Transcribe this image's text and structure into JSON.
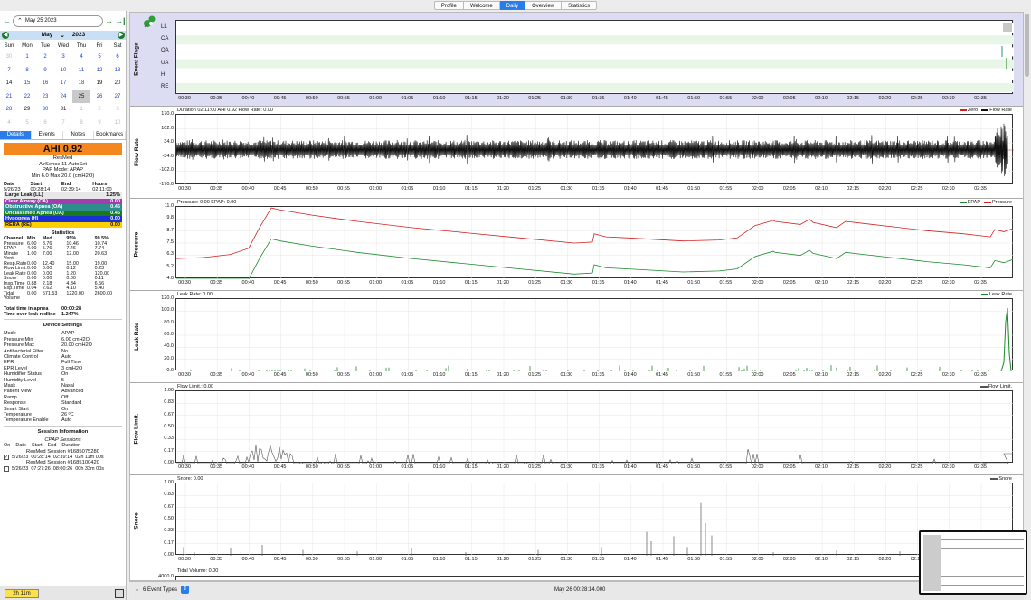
{
  "top_tabs": [
    "Profile",
    "Welcome",
    "Daily",
    "Overview",
    "Statistics"
  ],
  "active_tab": "Daily",
  "date_nav": {
    "date": "May 25 2023",
    "prev": "←",
    "next": "→",
    "last": "→|"
  },
  "calendar": {
    "month": "May",
    "year": "2023",
    "weekdays": [
      "Sun",
      "Mon",
      "Tue",
      "Wed",
      "Thu",
      "Fri",
      "Sat"
    ],
    "days": [
      {
        "d": "30",
        "t": "other"
      },
      {
        "d": "1",
        "t": "blue"
      },
      {
        "d": "2",
        "t": "blue"
      },
      {
        "d": "3",
        "t": "blue"
      },
      {
        "d": "4",
        "t": "blue"
      },
      {
        "d": "5",
        "t": "blue"
      },
      {
        "d": "6",
        "t": "blue"
      },
      {
        "d": "7",
        "t": "blue"
      },
      {
        "d": "8",
        "t": "blue"
      },
      {
        "d": "9",
        "t": "blue"
      },
      {
        "d": "10",
        "t": "blue"
      },
      {
        "d": "11",
        "t": "blue"
      },
      {
        "d": "12",
        "t": "blue"
      },
      {
        "d": "13",
        "t": "blue"
      },
      {
        "d": "14",
        "t": "black"
      },
      {
        "d": "15",
        "t": "blue"
      },
      {
        "d": "16",
        "t": "blue"
      },
      {
        "d": "17",
        "t": "blue"
      },
      {
        "d": "18",
        "t": "blue"
      },
      {
        "d": "19",
        "t": "black"
      },
      {
        "d": "20",
        "t": "black"
      },
      {
        "d": "21",
        "t": "blue"
      },
      {
        "d": "22",
        "t": "blue"
      },
      {
        "d": "23",
        "t": "blue"
      },
      {
        "d": "24",
        "t": "blue"
      },
      {
        "d": "25",
        "t": "sel"
      },
      {
        "d": "26",
        "t": "blue"
      },
      {
        "d": "27",
        "t": "blue"
      },
      {
        "d": "28",
        "t": "blue"
      },
      {
        "d": "29",
        "t": "black"
      },
      {
        "d": "30",
        "t": "blue"
      },
      {
        "d": "31",
        "t": "black"
      },
      {
        "d": "1",
        "t": "other"
      },
      {
        "d": "2",
        "t": "other"
      },
      {
        "d": "3",
        "t": "other"
      },
      {
        "d": "4",
        "t": "other"
      },
      {
        "d": "5",
        "t": "other"
      },
      {
        "d": "6",
        "t": "other"
      },
      {
        "d": "7",
        "t": "other"
      },
      {
        "d": "8",
        "t": "other"
      },
      {
        "d": "9",
        "t": "other"
      },
      {
        "d": "10",
        "t": "other"
      }
    ]
  },
  "left_tabs": [
    "Details",
    "Events",
    "Notes",
    "Bookmarks"
  ],
  "summary": {
    "ahi": "AHI 0.92",
    "machine_brand": "ResMed",
    "machine_model": "AirSense 11 AutoSet",
    "pap_mode": "PAP Mode: APAP",
    "pressure_range": "Min 6.0 Max 20.0 (cmH2O)",
    "headers": [
      "Date",
      "Start",
      "End",
      "Hours"
    ],
    "row": [
      "5/26/23",
      "00:28:14",
      "02:39:14",
      "02:11:00"
    ]
  },
  "events": [
    {
      "name": "Large Leak (LL)",
      "value": "1.25%",
      "bg": "#e8e8e8",
      "fg": "#111111"
    },
    {
      "name": "Clear Airway (CA)",
      "value": "0.00",
      "bg": "#a23db0",
      "fg": "#ffffff"
    },
    {
      "name": "Obstructive Apnea (OA)",
      "value": "0.46",
      "bg": "#2d8c8c",
      "fg": "#ffffff"
    },
    {
      "name": "Unclassified Apnea (UA)",
      "value": "0.46",
      "bg": "#1a7a1a",
      "fg": "#ffffff"
    },
    {
      "name": "Hypopnea (H)",
      "value": "0.00",
      "bg": "#1a2fd4",
      "fg": "#ffffff"
    },
    {
      "name": "RERA (RE)",
      "value": "0.00",
      "bg": "#ffd000",
      "fg": "#111111"
    }
  ],
  "statistics": {
    "title": "Statistics",
    "headers": [
      "Channel",
      "Min",
      "Med",
      "95%",
      "99.5%"
    ],
    "rows": [
      [
        "Pressure",
        "6.00",
        "8.76",
        "10.46",
        "10.74"
      ],
      [
        "EPAP",
        "4.00",
        "5.76",
        "7.46",
        "7.74"
      ],
      [
        "Minute Vent.",
        "1.00",
        "7.00",
        "12.00",
        "20.63"
      ],
      [
        "Resp.Rate",
        "0.00",
        "12.40",
        "15.00",
        "19.00"
      ],
      [
        "Flow Limit.",
        "0.00",
        "0.00",
        "0.12",
        "0.23"
      ],
      [
        "Leak Rate",
        "0.00",
        "0.00",
        "1.20",
        "120.00"
      ],
      [
        "Snore",
        "0.00",
        "0.00",
        "0.00",
        "0.11"
      ],
      [
        "Insp.Time",
        "0.88",
        "2.18",
        "4.34",
        "6.56"
      ],
      [
        "Exp.Time",
        "0.04",
        "2.62",
        "4.10",
        "5.40"
      ],
      [
        "Tidal Volume",
        "0.00",
        "571.53",
        "1220.00",
        "2600.00"
      ]
    ]
  },
  "totals": [
    {
      "k": "Total time in apnea",
      "v": "00:00:28"
    },
    {
      "k": "Time over leak redline",
      "v": "1.247%"
    }
  ],
  "device_settings": {
    "title": "Device Settings",
    "items": [
      {
        "k": "Mode",
        "v": "APAP"
      },
      {
        "k": "Pressure Min",
        "v": "6.00 cmH2O"
      },
      {
        "k": "Pressure Max",
        "v": "20.00 cmH2O"
      },
      {
        "k": "Antibacterial Filter",
        "v": "No"
      },
      {
        "k": "Climate Control",
        "v": "Auto"
      },
      {
        "k": "EPR",
        "v": "Full Time"
      },
      {
        "k": "EPR Level",
        "v": "3 cmH2O"
      },
      {
        "k": "Humidifier Status",
        "v": "On"
      },
      {
        "k": "Humidity Level",
        "v": "5"
      },
      {
        "k": "Mask",
        "v": "Nasal"
      },
      {
        "k": "Patient View",
        "v": "Advanced"
      },
      {
        "k": "Ramp",
        "v": "Off"
      },
      {
        "k": "Response",
        "v": "Standard"
      },
      {
        "k": "Smart Start",
        "v": "On"
      },
      {
        "k": "Temperature",
        "v": "26 ºC"
      },
      {
        "k": "Temperature Enable",
        "v": "Auto"
      }
    ]
  },
  "session_info": {
    "title": "Session Information",
    "subtitle": "CPAP Sessions",
    "headers": [
      "On",
      "Date",
      "Start",
      "End",
      "Duration"
    ],
    "sessions": [
      {
        "label": "ResMed Session #1685075280",
        "checked": true,
        "date": "5/26/23",
        "start": "00:28:14",
        "end": "02:39:14",
        "dur": "02h 11m 00s"
      },
      {
        "label": "ResMed Session #1685100420",
        "checked": false,
        "date": "5/26/23",
        "start": "07:27:26",
        "end": "08:00:26",
        "dur": "00h 33m 00s"
      }
    ]
  },
  "duration_badge": "2h 11m",
  "x_ticks": [
    "00:30",
    "00:35",
    "00:40",
    "00:45",
    "00:50",
    "00:55",
    "01:00",
    "01:05",
    "01:10",
    "01:15",
    "01:20",
    "01:25",
    "01:30",
    "01:35",
    "01:40",
    "01:45",
    "01:50",
    "01:55",
    "02:00",
    "02:05",
    "02:10",
    "02:15",
    "02:20",
    "02:25",
    "02:30",
    "02:35"
  ],
  "graphs": {
    "event_flags": {
      "ylabel": "Event Flags",
      "flags": [
        "LL",
        "CA",
        "OA",
        "UA",
        "H",
        "RE"
      ]
    },
    "flow_rate": {
      "ylabel": "Flow Rate",
      "header": "Duration 02:11:00 AHI 0.92 Flow Rate: 0.00",
      "ticks": [
        "170.0",
        "102.0",
        "34.0",
        "-34.0",
        "-102.0",
        "-170.0"
      ],
      "legend": [
        {
          "name": "Zero",
          "color": "#d42020"
        },
        {
          "name": "Flow Rate",
          "color": "#111111"
        }
      ]
    },
    "pressure": {
      "ylabel": "Pressure",
      "header": "Pressure: 0.00 EPAP: 0.00",
      "ticks": [
        "11.0",
        "9.8",
        "8.7",
        "7.5",
        "6.3",
        "5.2",
        "4.0"
      ],
      "legend": [
        {
          "name": "EPAP",
          "color": "#1a8a2a"
        },
        {
          "name": "Pressure",
          "color": "#d42020"
        }
      ]
    },
    "leak_rate": {
      "ylabel": "Leak Rate",
      "header": "Leak Rate: 0.00",
      "ticks": [
        "120.0",
        "100.0",
        "80.0",
        "60.0",
        "40.0",
        "20.0",
        "0.0"
      ],
      "legend": [
        {
          "name": "Leak Rate",
          "color": "#1a8a2a"
        }
      ]
    },
    "flow_limit": {
      "ylabel": "Flow Limit.",
      "header": "Flow Limit.: 0.00",
      "ticks": [
        "1.00",
        "0.83",
        "0.67",
        "0.50",
        "0.33",
        "0.17",
        "0.00"
      ],
      "legend": [
        {
          "name": "Flow Limit.",
          "color": "#555555"
        }
      ]
    },
    "snore": {
      "ylabel": "Snore",
      "header": "Snore: 0.00",
      "ticks": [
        "1.00",
        "0.83",
        "0.67",
        "0.50",
        "0.33",
        "0.17",
        "0.00"
      ],
      "legend": [
        {
          "name": "Snore",
          "color": "#555555"
        }
      ]
    },
    "tidal": {
      "header": "Tidal Volume: 0.00",
      "tick": "4000.0"
    }
  },
  "status": {
    "event_types": "6 Event Types",
    "time": "May 26 00:28:14.000"
  }
}
